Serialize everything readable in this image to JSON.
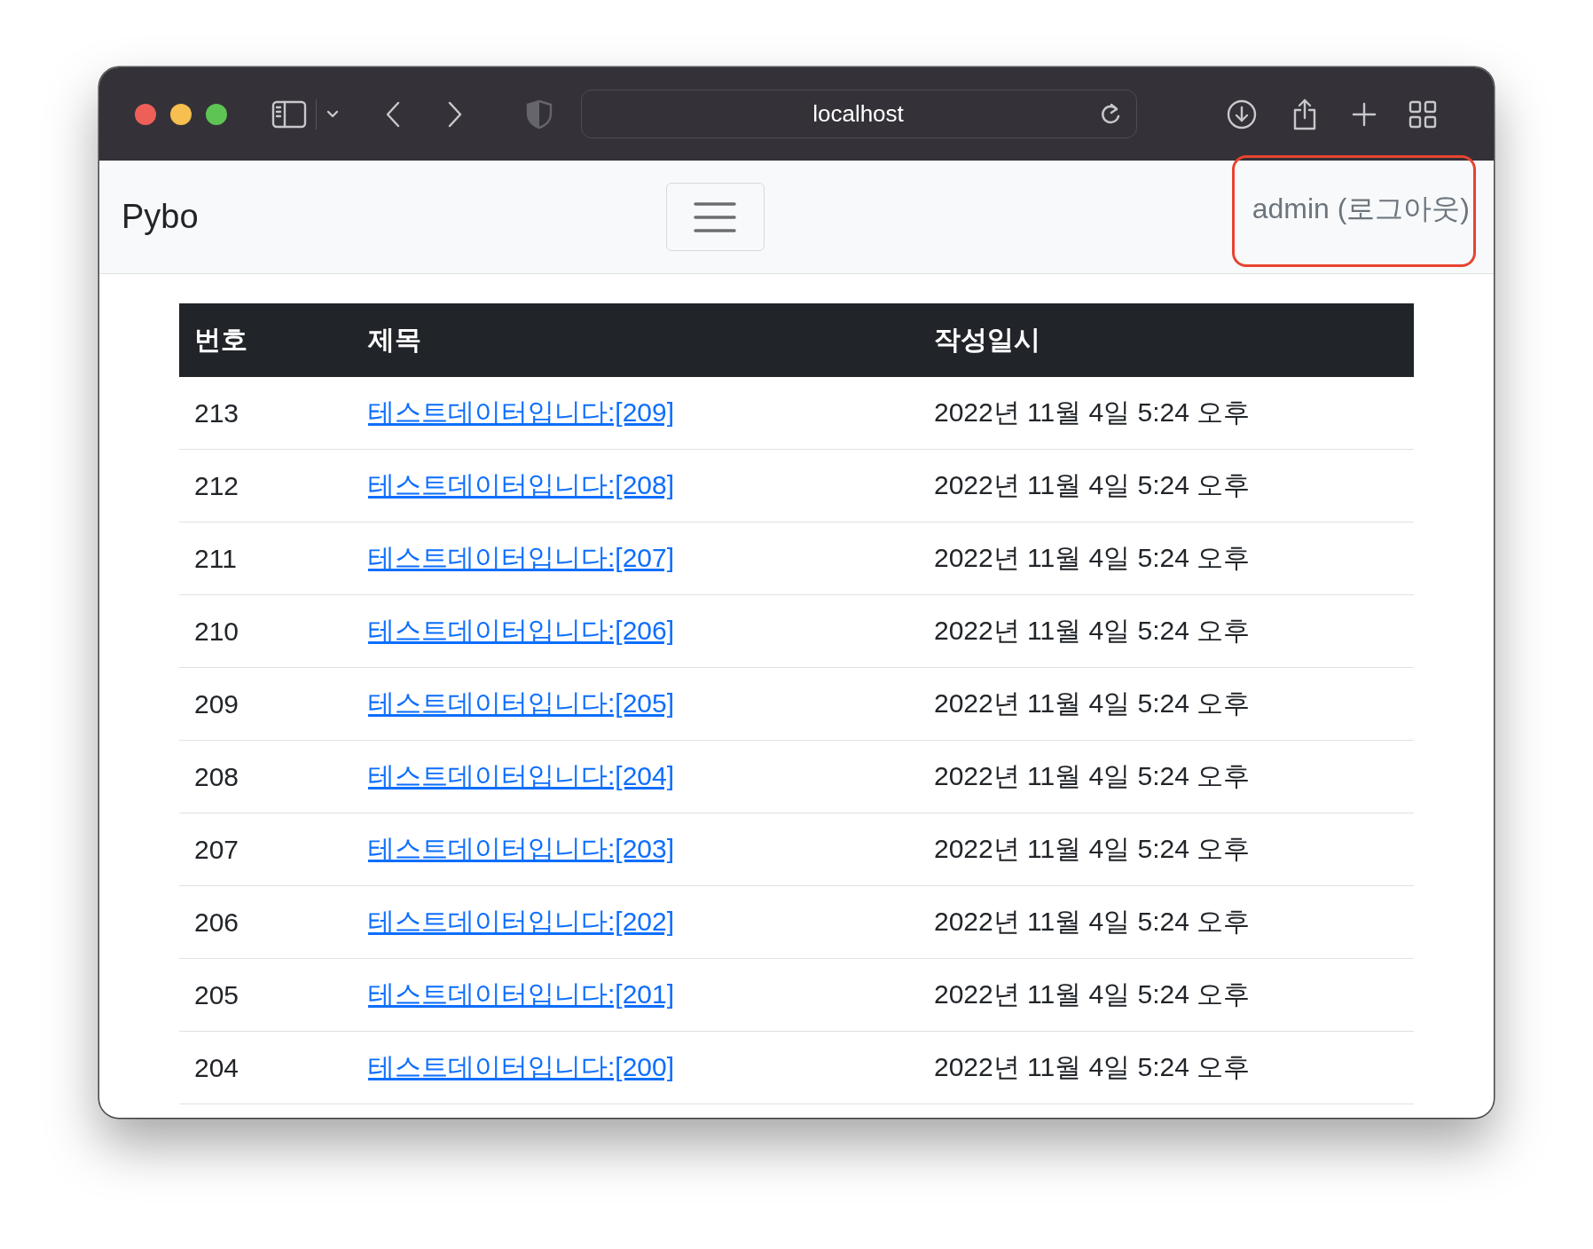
{
  "browser": {
    "address": "localhost"
  },
  "navbar": {
    "brand": "Pybo",
    "user_link": "admin (로그아웃)"
  },
  "table": {
    "columns": [
      "번호",
      "제목",
      "작성일시"
    ],
    "rows": [
      {
        "number": "213",
        "title": "테스트데이터입니다:[209]",
        "date": "2022년 11월 4일 5:24 오후"
      },
      {
        "number": "212",
        "title": "테스트데이터입니다:[208]",
        "date": "2022년 11월 4일 5:24 오후"
      },
      {
        "number": "211",
        "title": "테스트데이터입니다:[207]",
        "date": "2022년 11월 4일 5:24 오후"
      },
      {
        "number": "210",
        "title": "테스트데이터입니다:[206]",
        "date": "2022년 11월 4일 5:24 오후"
      },
      {
        "number": "209",
        "title": "테스트데이터입니다:[205]",
        "date": "2022년 11월 4일 5:24 오후"
      },
      {
        "number": "208",
        "title": "테스트데이터입니다:[204]",
        "date": "2022년 11월 4일 5:24 오후"
      },
      {
        "number": "207",
        "title": "테스트데이터입니다:[203]",
        "date": "2022년 11월 4일 5:24 오후"
      },
      {
        "number": "206",
        "title": "테스트데이터입니다:[202]",
        "date": "2022년 11월 4일 5:24 오후"
      },
      {
        "number": "205",
        "title": "테스트데이터입니다:[201]",
        "date": "2022년 11월 4일 5:24 오후"
      },
      {
        "number": "204",
        "title": "테스트데이터입니다:[200]",
        "date": "2022년 11월 4일 5:24 오후"
      }
    ]
  }
}
